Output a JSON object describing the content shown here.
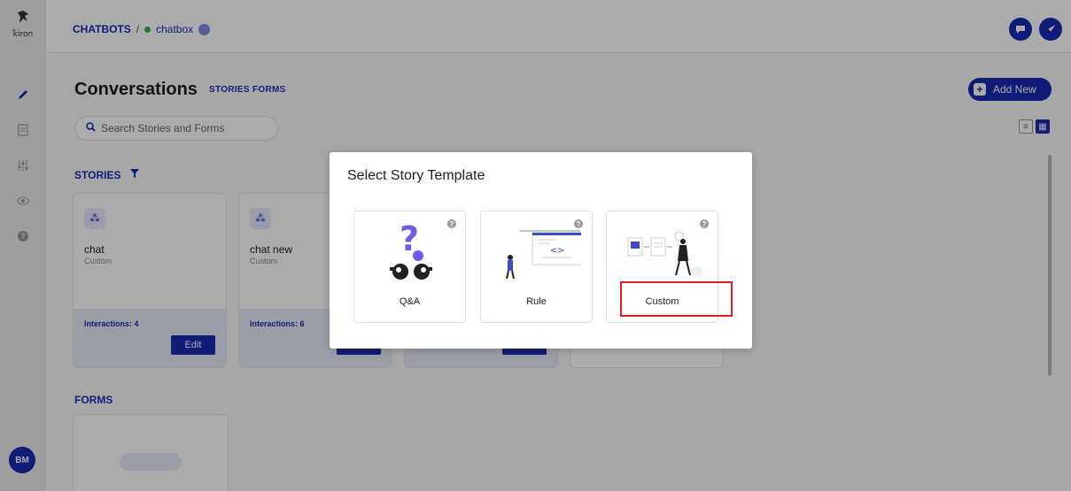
{
  "brand": {
    "logo_text": "k̂iron"
  },
  "breadcrumb": {
    "root": "CHATBOTS",
    "separator": "/",
    "current": "chatbox"
  },
  "page": {
    "title": "Conversations",
    "tabs": [
      "STORIES",
      "FORMS"
    ],
    "add_new_label": "Add New",
    "search_placeholder": "Search Stories and Forms"
  },
  "stories_section": {
    "title": "STORIES",
    "cards": [
      {
        "name": "chat",
        "type": "Custom",
        "interactions": "Interactions: 4",
        "edit_label": "Edit"
      },
      {
        "name": "chat new",
        "type": "Custom",
        "interactions": "Interactions: 6",
        "edit_label": "Edit"
      }
    ]
  },
  "forms_section": {
    "title": "FORMS"
  },
  "user": {
    "initials": "BM"
  },
  "modal": {
    "title": "Select Story Template",
    "templates": [
      {
        "label": "Q&A",
        "icon": "qa-illustration"
      },
      {
        "label": "Rule",
        "icon": "rule-illustration"
      },
      {
        "label": "Custom",
        "icon": "custom-illustration"
      }
    ]
  },
  "colors": {
    "primary": "#1a2bb5",
    "highlight": "#e02020",
    "status_online": "#2db34a"
  }
}
